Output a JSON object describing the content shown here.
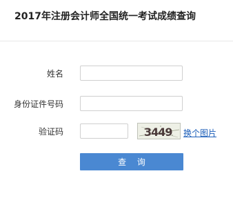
{
  "header": {
    "title": "2017年注册会计师全国统一考试成绩查询"
  },
  "form": {
    "name": {
      "label": "姓名",
      "value": ""
    },
    "id_number": {
      "label": "身份证件号码",
      "value": ""
    },
    "captcha": {
      "label": "验证码",
      "value": "",
      "image_text": "3449",
      "refresh_label": "换个图片"
    },
    "submit_label": "查 询"
  }
}
